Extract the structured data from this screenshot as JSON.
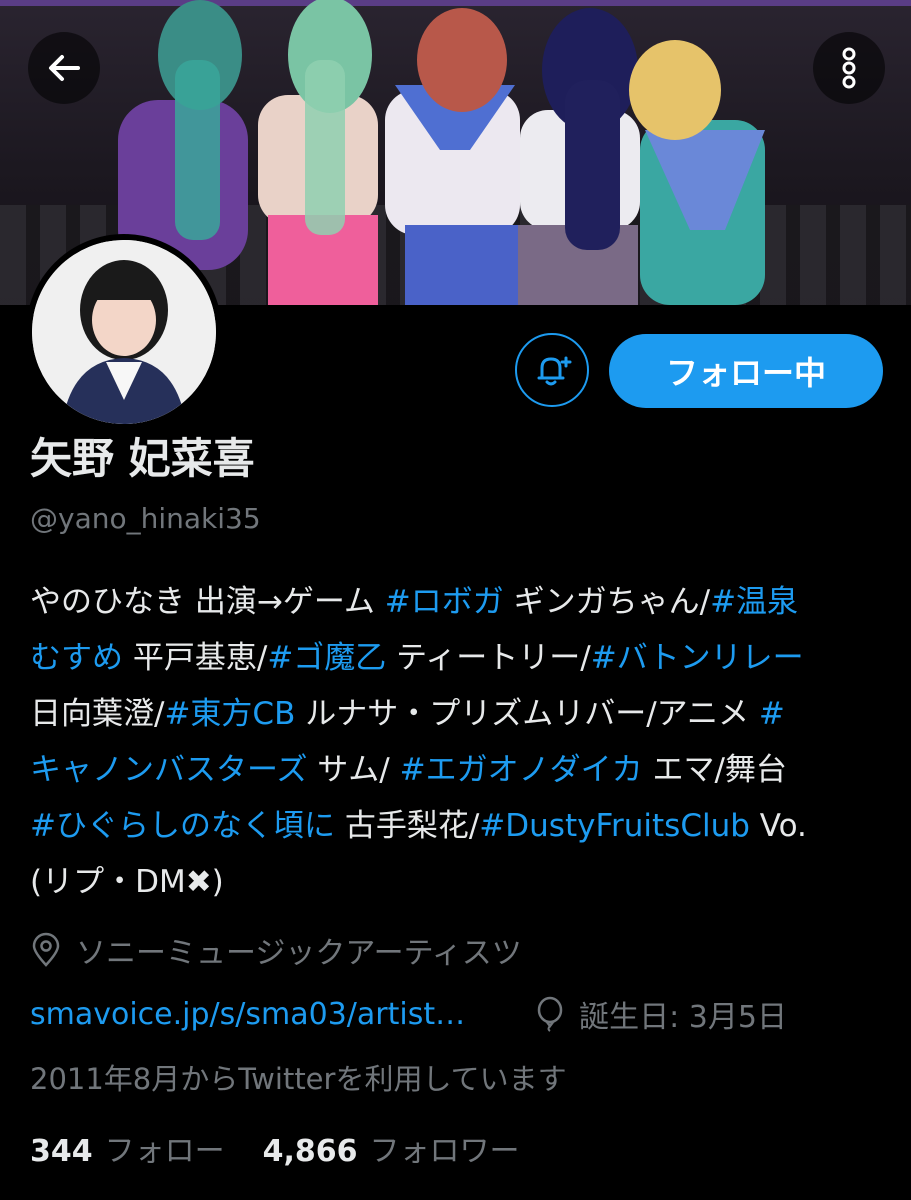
{
  "header": {
    "back_icon": "arrow-left-icon",
    "more_icon": "more-vertical-icon"
  },
  "profile": {
    "name": "矢野 妃菜喜",
    "handle": "@yano_hinaki35",
    "follow_button_label": "フォロー中",
    "bell_icon": "bell-plus-icon"
  },
  "bio": {
    "lines": [
      [
        {
          "t": "やのひなき 出演→ゲーム ",
          "tag": false
        },
        {
          "t": "#ロボガ",
          "tag": true
        },
        {
          "t": " ギンガちゃん/",
          "tag": false
        },
        {
          "t": "#温泉",
          "tag": true
        }
      ],
      [
        {
          "t": "むすめ",
          "tag": true
        },
        {
          "t": " 平戸基恵/",
          "tag": false
        },
        {
          "t": "#ゴ魔乙",
          "tag": true
        },
        {
          "t": " ティートリー/",
          "tag": false
        },
        {
          "t": "#バトンリレー",
          "tag": true
        }
      ],
      [
        {
          "t": "日向葉澄/",
          "tag": false
        },
        {
          "t": "#東方CB",
          "tag": true
        },
        {
          "t": " ルナサ・プリズムリバー/アニメ ",
          "tag": false
        },
        {
          "t": "#",
          "tag": true
        }
      ],
      [
        {
          "t": "キャノンバスターズ",
          "tag": true
        },
        {
          "t": " サム/ ",
          "tag": false
        },
        {
          "t": "#エガオノダイカ",
          "tag": true
        },
        {
          "t": " エマ/舞台",
          "tag": false
        }
      ],
      [
        {
          "t": "#ひぐらしのなく頃に",
          "tag": true
        },
        {
          "t": " 古手梨花/",
          "tag": false
        },
        {
          "t": "#DustyFruitsClub",
          "tag": true
        },
        {
          "t": " Vo.",
          "tag": false
        }
      ],
      [
        {
          "t": "(リプ・DM✖)",
          "tag": false
        }
      ]
    ]
  },
  "details": {
    "location": "ソニーミュージックアーティスツ",
    "location_icon": "location-pin-icon",
    "website": "smavoice.jp/s/sma03/artist…",
    "birthday": "誕生日: 3月5日",
    "birthday_icon": "balloon-icon",
    "joined": "2011年8月からTwitterを利用しています"
  },
  "stats": {
    "following_count": "344",
    "following_label": "フォロー",
    "followers_count": "4,866",
    "followers_label": "フォロワー"
  },
  "colors": {
    "accent": "#1d9bf0",
    "background": "#000000",
    "secondary_text": "#71767b"
  }
}
